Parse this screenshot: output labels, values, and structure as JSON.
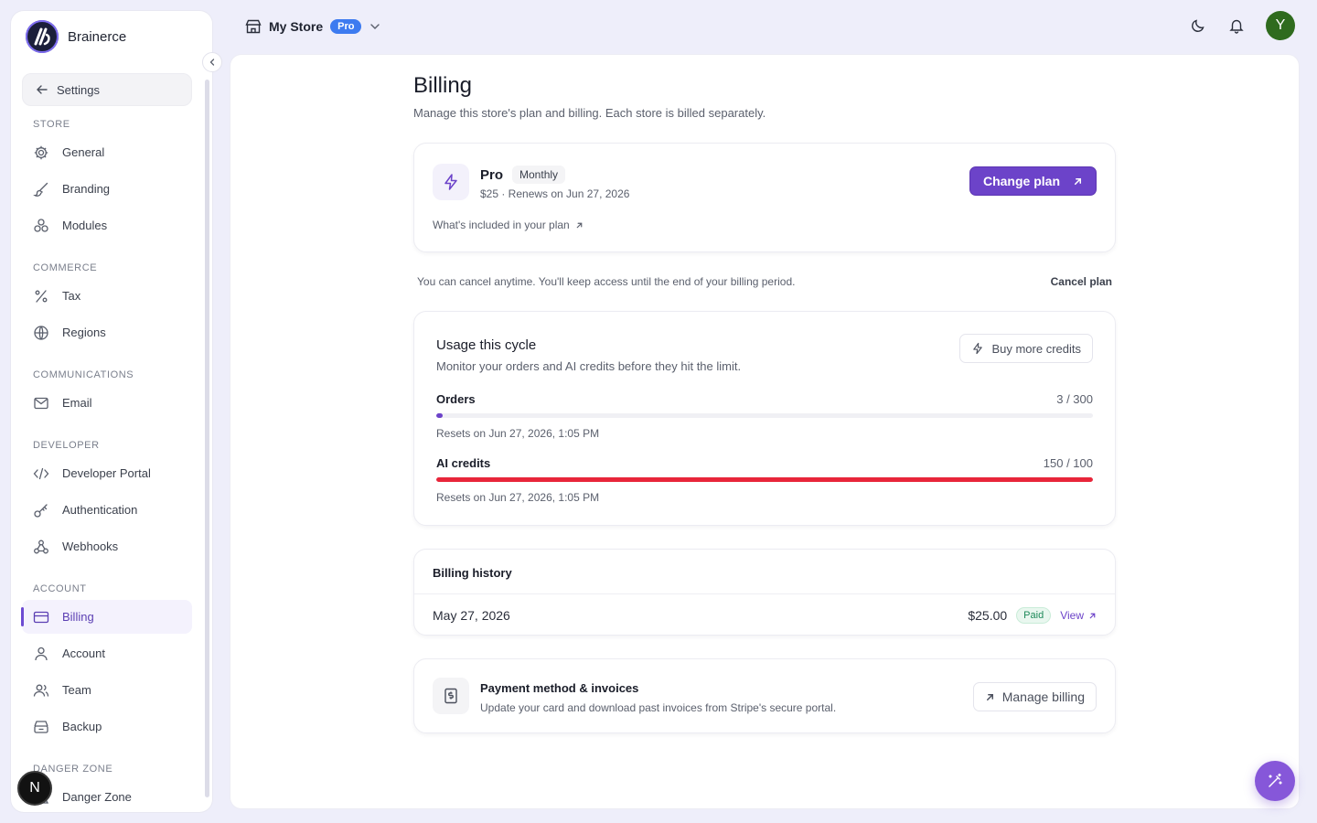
{
  "brand": {
    "name": "Brainerce"
  },
  "sidebar": {
    "back_label": "Settings",
    "groups": [
      {
        "label": "STORE",
        "items": [
          {
            "label": "General",
            "icon": "gear-icon"
          },
          {
            "label": "Branding",
            "icon": "brush-icon"
          },
          {
            "label": "Modules",
            "icon": "modules-icon"
          }
        ]
      },
      {
        "label": "COMMERCE",
        "items": [
          {
            "label": "Tax",
            "icon": "percent-icon"
          },
          {
            "label": "Regions",
            "icon": "globe-icon"
          }
        ]
      },
      {
        "label": "COMMUNICATIONS",
        "items": [
          {
            "label": "Email",
            "icon": "mail-icon"
          }
        ]
      },
      {
        "label": "DEVELOPER",
        "items": [
          {
            "label": "Developer Portal",
            "icon": "code-icon"
          },
          {
            "label": "Authentication",
            "icon": "key-icon"
          },
          {
            "label": "Webhooks",
            "icon": "webhook-icon"
          }
        ]
      },
      {
        "label": "ACCOUNT",
        "items": [
          {
            "label": "Billing",
            "icon": "card-icon",
            "active": true
          },
          {
            "label": "Account",
            "icon": "user-icon"
          },
          {
            "label": "Team",
            "icon": "users-icon"
          },
          {
            "label": "Backup",
            "icon": "archive-icon"
          }
        ]
      },
      {
        "label": "DANGER ZONE",
        "items": [
          {
            "label": "Danger Zone",
            "icon": "warning-icon"
          }
        ]
      }
    ]
  },
  "topbar": {
    "store_name": "My Store",
    "plan_badge": "Pro",
    "avatar_initial": "Y"
  },
  "floating": {
    "n_badge": "N"
  },
  "page": {
    "title": "Billing",
    "subtitle": "Manage this store's plan and billing. Each store is billed separately."
  },
  "plan": {
    "name": "Pro",
    "cycle": "Monthly",
    "meta": "$25 · Renews on Jun 27, 2026",
    "included_link": "What's included in your plan",
    "change_button": "Change plan"
  },
  "cancel": {
    "note": "You can cancel anytime. You'll keep access until the end of your billing period.",
    "button": "Cancel plan"
  },
  "usage": {
    "title": "Usage this cycle",
    "subtitle": "Monitor your orders and AI credits before they hit the limit.",
    "buy_button": "Buy more credits",
    "meters": [
      {
        "label": "Orders",
        "value": "3 / 300",
        "fraction": 0.01,
        "color": "#6c43c9",
        "reset": "Resets on Jun 27, 2026, 1:05 PM"
      },
      {
        "label": "AI credits",
        "value": "150 / 100",
        "fraction": 1.0,
        "color": "#e8253a",
        "reset": "Resets on Jun 27, 2026, 1:05 PM"
      }
    ]
  },
  "history": {
    "title": "Billing history",
    "rows": [
      {
        "date": "May 27, 2026",
        "amount": "$25.00",
        "status": "Paid",
        "action": "View"
      }
    ]
  },
  "payment": {
    "title": "Payment method & invoices",
    "subtitle": "Update your card and download past invoices from Stripe's secure portal.",
    "button": "Manage billing"
  },
  "colors": {
    "accent": "#6c43c9",
    "danger": "#e8253a",
    "pro_badge": "#3d7bf0",
    "avatar": "#2f6b1e"
  }
}
